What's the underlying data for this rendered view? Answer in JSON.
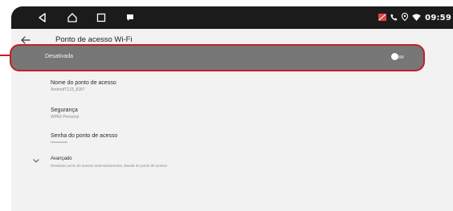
{
  "status_bar": {
    "time": "09:59",
    "icons": [
      "back-icon",
      "home-icon",
      "recent-apps-icon",
      "message-icon",
      "signal-icon",
      "phone-icon",
      "location-icon",
      "wifi-icon"
    ]
  },
  "app_bar": {
    "title": "Ponto de acesso Wi-Fi"
  },
  "hotspot_toggle": {
    "label": "Desativada",
    "state": "off"
  },
  "settings": {
    "name": {
      "title": "Nome do ponto de acesso",
      "value": "AndroidT123_8287"
    },
    "security": {
      "title": "Segurança",
      "value": "WPA2-Personal"
    },
    "password": {
      "title": "Senha do ponto de acesso",
      "value": "••••••••••••"
    },
    "advanced": {
      "title": "Avançado",
      "summary": "Desativar ponto de acesso automaticamente, Banda do ponto de acesso"
    }
  },
  "colors": {
    "highlight_border": "#c0202b",
    "toggle_row_bg": "#777777",
    "status_bar_bg": "#1b1b1b"
  }
}
